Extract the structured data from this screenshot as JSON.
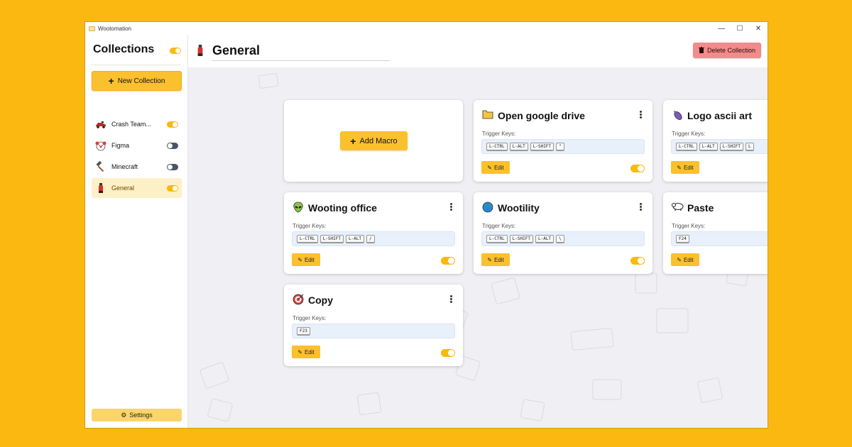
{
  "app": {
    "title": "Wootomation"
  },
  "window_controls": {
    "minimize": "—",
    "maximize": "☐",
    "close": "✕"
  },
  "sidebar": {
    "title": "Collections",
    "new_collection": "New Collection",
    "items": [
      {
        "label": "Crash Team...",
        "icon": "race-car-icon",
        "enabled": true,
        "active": false
      },
      {
        "label": "Figma",
        "icon": "clown-face-icon",
        "enabled": false,
        "active": false
      },
      {
        "label": "Minecraft",
        "icon": "hammer-icon",
        "enabled": false,
        "active": false
      },
      {
        "label": "General",
        "icon": "fire-extinguisher-icon",
        "enabled": true,
        "active": true
      }
    ],
    "settings": "Settings"
  },
  "header": {
    "title": "General",
    "delete": "Delete Collection"
  },
  "add_macro": "Add Macro",
  "macros": [
    {
      "title": "Open google drive",
      "icon": "folder-icon",
      "trigger_label": "Trigger Keys:",
      "keys": [
        "L-CTRL",
        "L-ALT",
        "L-SHIFT",
        "\""
      ],
      "edit": "Edit",
      "enabled": true
    },
    {
      "title": "Logo ascii art",
      "icon": "eggplant-icon",
      "trigger_label": "Trigger Keys:",
      "keys": [
        "L-CTRL",
        "L-ALT",
        "L-SHIFT",
        "L"
      ],
      "edit": "Edit",
      "enabled": true
    },
    {
      "title": "Wooting office",
      "icon": "alien-icon",
      "trigger_label": "Trigger Keys:",
      "keys": [
        "L-CTRL",
        "L-SHIFT",
        "L-ALT",
        "/"
      ],
      "edit": "Edit",
      "enabled": true
    },
    {
      "title": "Wootility",
      "icon": "globe-icon",
      "trigger_label": "Trigger Keys:",
      "keys": [
        "L-CTRL",
        "L-SHIFT",
        "L-ALT",
        "\\"
      ],
      "edit": "Edit",
      "enabled": true
    },
    {
      "title": "Paste",
      "icon": "ram-icon",
      "trigger_label": "Trigger Keys:",
      "keys": [
        "F24"
      ],
      "edit": "Edit",
      "enabled": true
    },
    {
      "title": "Copy",
      "icon": "target-icon",
      "trigger_label": "Trigger Keys:",
      "keys": [
        "F23"
      ],
      "edit": "Edit",
      "enabled": true
    }
  ],
  "colors": {
    "accent": "#fbc02d",
    "background": "#fbb810",
    "danger": "#f28b8b"
  }
}
